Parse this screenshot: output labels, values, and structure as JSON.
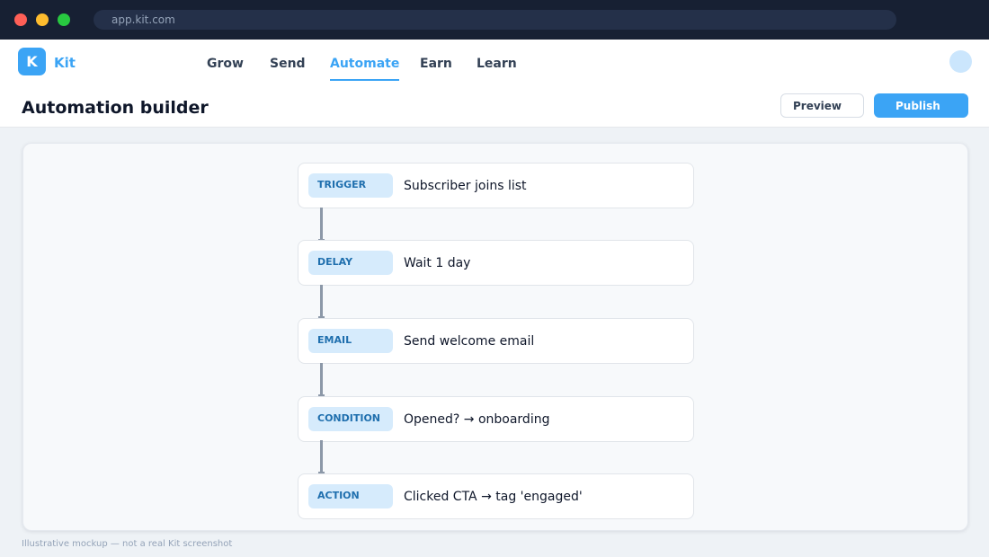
{
  "browser": {
    "url": "app.kit.com"
  },
  "header": {
    "logo_letter": "K",
    "logo_text": "Kit",
    "nav": [
      {
        "label": "Grow"
      },
      {
        "label": "Send"
      },
      {
        "label": "Automate",
        "active": true
      },
      {
        "label": "Earn"
      },
      {
        "label": "Learn"
      }
    ]
  },
  "page": {
    "title": "Automation builder",
    "preview_label": "Preview",
    "publish_label": "Publish"
  },
  "workflow": {
    "steps": [
      {
        "type": "TRIGGER",
        "label": "Subscriber joins list"
      },
      {
        "type": "DELAY",
        "label": "Wait 1 day"
      },
      {
        "type": "EMAIL",
        "label": "Send welcome email"
      },
      {
        "type": "CONDITION",
        "label": "Opened? → onboarding"
      },
      {
        "type": "ACTION",
        "label": "Clicked CTA → tag 'engaged'"
      }
    ]
  },
  "footer": {
    "disclaimer": "Illustrative mockup — not a real Kit screenshot"
  },
  "colors": {
    "accent": "#3ba4f5",
    "browser_chrome": "#172033",
    "badge_bg": "#d6ebfc",
    "badge_text": "#1f6fae",
    "connector": "#8c98a8"
  }
}
